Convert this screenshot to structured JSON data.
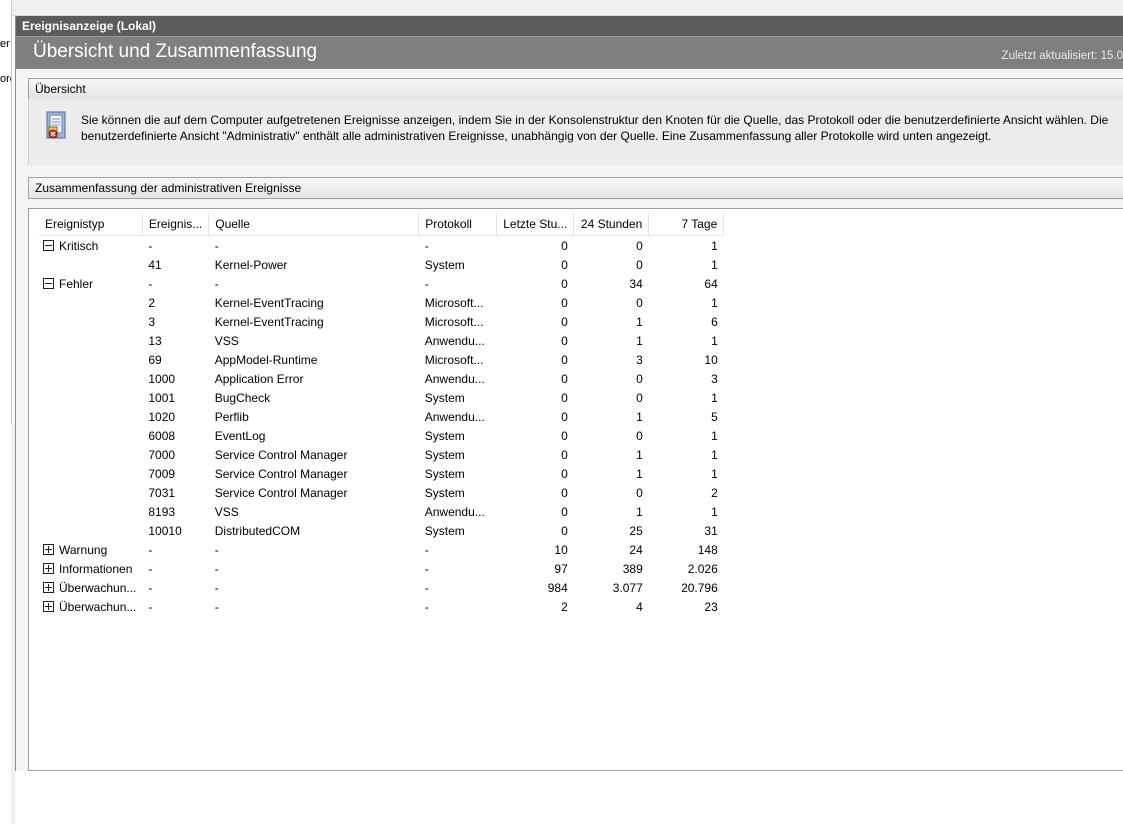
{
  "left_pane": {
    "fragments": [
      "er",
      "orc"
    ]
  },
  "title_bar": {
    "text": "Ereignisanzeige (Lokal)"
  },
  "banner": {
    "title": "Übersicht und Zusammenfassung",
    "updated": "Zuletzt aktualisiert: 15.0"
  },
  "overview": {
    "header": "Übersicht",
    "icon": "event-log-icon",
    "text": "Sie können die auf dem Computer aufgetretenen Ereignisse anzeigen, indem Sie in der Konsolenstruktur den Knoten für die Quelle, das Protokoll oder die benutzerdefinierte Ansicht wählen. Die benutzerdefinierte Ansicht \"Administrativ\" enthält alle administrativen Ereignisse, unabhängig von der Quelle. Eine Zusammenfassung aller Protokolle wird unten angezeigt."
  },
  "summary": {
    "header": "Zusammenfassung der administrativen Ereignisse",
    "columns": [
      "Ereignistyp",
      "Ereignis...",
      "Quelle",
      "Protokoll",
      "Letzte Stu...",
      "24 Stunden",
      "7 Tage"
    ],
    "rows": [
      {
        "expander": "minus",
        "type": "Kritisch",
        "id": "-",
        "source": "-",
        "log": "-",
        "hour": "0",
        "day": "0",
        "week": "1"
      },
      {
        "expander": "",
        "type": "",
        "id": "41",
        "source": "Kernel-Power",
        "log": "System",
        "hour": "0",
        "day": "0",
        "week": "1"
      },
      {
        "expander": "minus",
        "type": "Fehler",
        "id": "-",
        "source": "-",
        "log": "-",
        "hour": "0",
        "day": "34",
        "week": "64"
      },
      {
        "expander": "",
        "type": "",
        "id": "2",
        "source": "Kernel-EventTracing",
        "log": "Microsoft...",
        "hour": "0",
        "day": "0",
        "week": "1"
      },
      {
        "expander": "",
        "type": "",
        "id": "3",
        "source": "Kernel-EventTracing",
        "log": "Microsoft...",
        "hour": "0",
        "day": "1",
        "week": "6"
      },
      {
        "expander": "",
        "type": "",
        "id": "13",
        "source": "VSS",
        "log": "Anwendu...",
        "hour": "0",
        "day": "1",
        "week": "1"
      },
      {
        "expander": "",
        "type": "",
        "id": "69",
        "source": "AppModel-Runtime",
        "log": "Microsoft...",
        "hour": "0",
        "day": "3",
        "week": "10"
      },
      {
        "expander": "",
        "type": "",
        "id": "1000",
        "source": "Application Error",
        "log": "Anwendu...",
        "hour": "0",
        "day": "0",
        "week": "3"
      },
      {
        "expander": "",
        "type": "",
        "id": "1001",
        "source": "BugCheck",
        "log": "System",
        "hour": "0",
        "day": "0",
        "week": "1"
      },
      {
        "expander": "",
        "type": "",
        "id": "1020",
        "source": "Perflib",
        "log": "Anwendu...",
        "hour": "0",
        "day": "1",
        "week": "5"
      },
      {
        "expander": "",
        "type": "",
        "id": "6008",
        "source": "EventLog",
        "log": "System",
        "hour": "0",
        "day": "0",
        "week": "1"
      },
      {
        "expander": "",
        "type": "",
        "id": "7000",
        "source": "Service Control Manager",
        "log": "System",
        "hour": "0",
        "day": "1",
        "week": "1"
      },
      {
        "expander": "",
        "type": "",
        "id": "7009",
        "source": "Service Control Manager",
        "log": "System",
        "hour": "0",
        "day": "1",
        "week": "1"
      },
      {
        "expander": "",
        "type": "",
        "id": "7031",
        "source": "Service Control Manager",
        "log": "System",
        "hour": "0",
        "day": "0",
        "week": "2"
      },
      {
        "expander": "",
        "type": "",
        "id": "8193",
        "source": "VSS",
        "log": "Anwendu...",
        "hour": "0",
        "day": "1",
        "week": "1"
      },
      {
        "expander": "",
        "type": "",
        "id": "10010",
        "source": "DistributedCOM",
        "log": "System",
        "hour": "0",
        "day": "25",
        "week": "31"
      },
      {
        "expander": "plus",
        "type": "Warnung",
        "id": "-",
        "source": "-",
        "log": "-",
        "hour": "10",
        "day": "24",
        "week": "148"
      },
      {
        "expander": "plus",
        "type": "Informationen",
        "id": "-",
        "source": "-",
        "log": "-",
        "hour": "97",
        "day": "389",
        "week": "2.026"
      },
      {
        "expander": "plus",
        "type": "Überwachun...",
        "id": "-",
        "source": "-",
        "log": "-",
        "hour": "984",
        "day": "3.077",
        "week": "20.796"
      },
      {
        "expander": "plus",
        "type": "Überwachun...",
        "id": "-",
        "source": "-",
        "log": "-",
        "hour": "2",
        "day": "4",
        "week": "23"
      }
    ]
  }
}
